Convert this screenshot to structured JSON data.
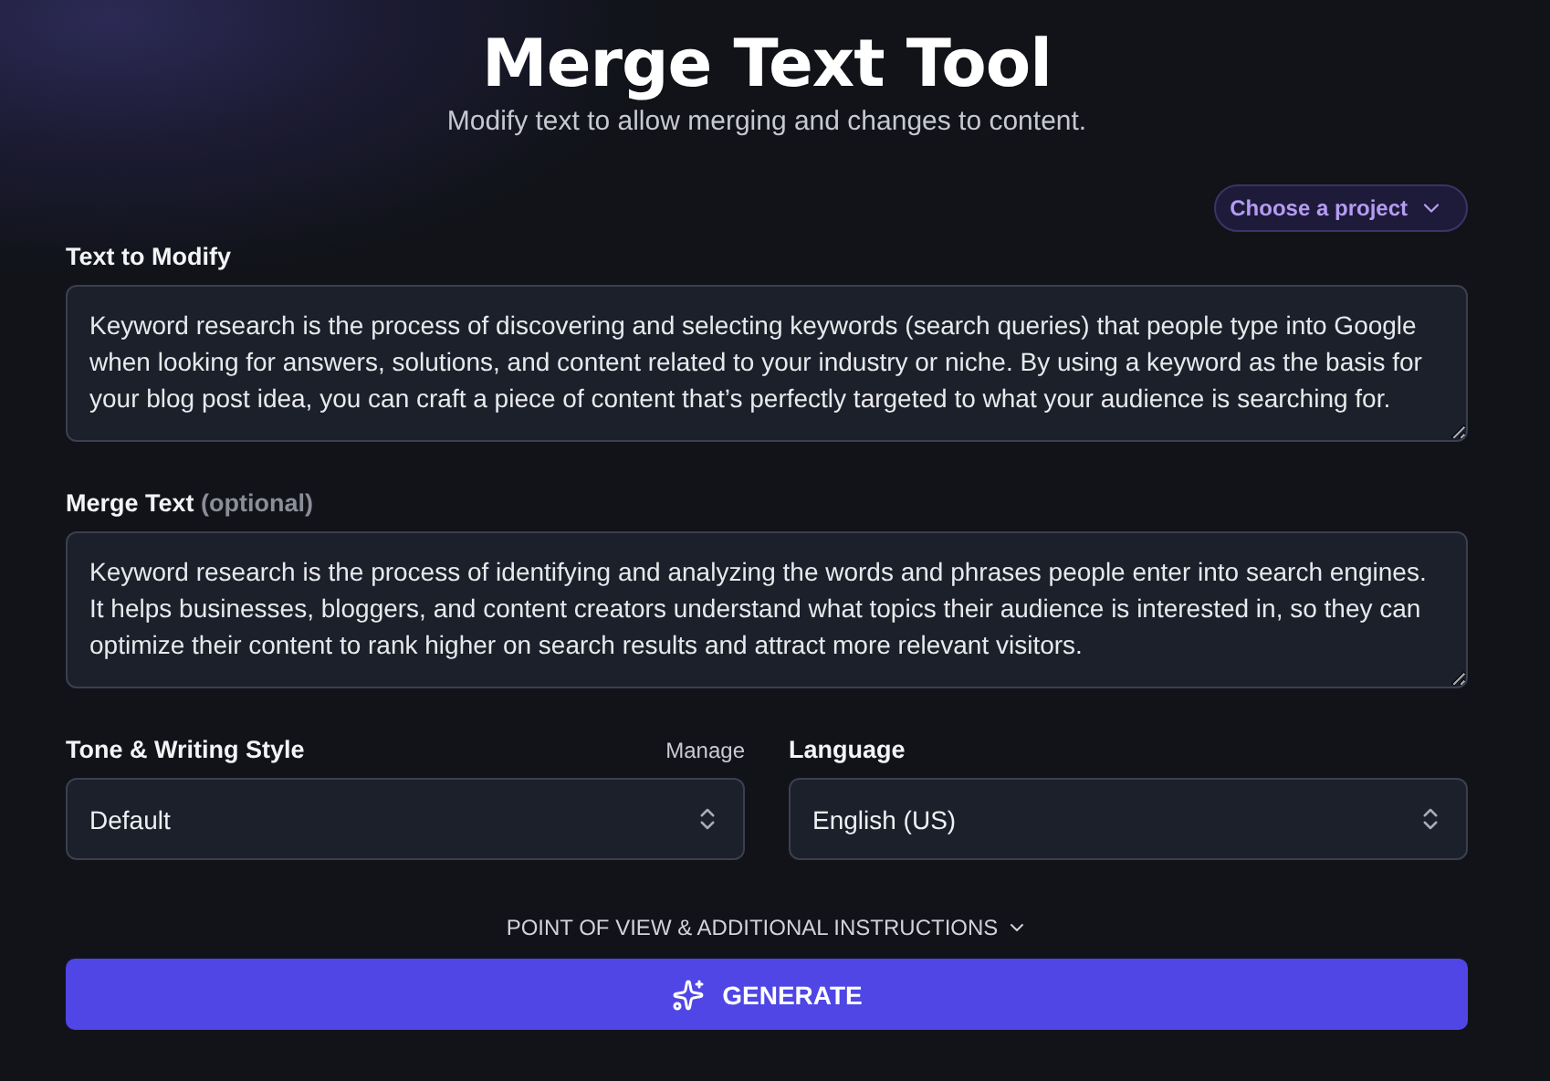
{
  "header": {
    "title": "Merge Text Tool",
    "subtitle": "Modify text to allow merging and changes to content."
  },
  "project_menu": {
    "label": "Choose a project"
  },
  "fields": [
    {
      "label": "Text to Modify",
      "value": "Keyword research is the process of discovering and selecting keywords (search queries) that people type into Google when looking for answers, solutions, and content related to your industry or niche. By using a keyword as the basis for your blog post idea, you can craft a piece of content that’s perfectly targeted to what your audience is searching for."
    },
    {
      "label": "Merge Text",
      "note": "(optional)",
      "value": "Keyword research is the process of identifying and analyzing the words and phrases people enter into search engines. It helps businesses, bloggers, and content creators understand what topics their audience is interested in, so they can optimize their content to rank higher on search results and attract more relevant visitors."
    }
  ],
  "selects": [
    {
      "label": "Tone & Writing Style",
      "action": "Manage",
      "value": "Default"
    },
    {
      "label": "Language",
      "value": "English (US)"
    }
  ],
  "instructions_toggle": {
    "label": "POINT OF VIEW & ADDITIONAL INSTRUCTIONS",
    "expanded": false
  },
  "generate_button": {
    "label": "GENERATE"
  }
}
